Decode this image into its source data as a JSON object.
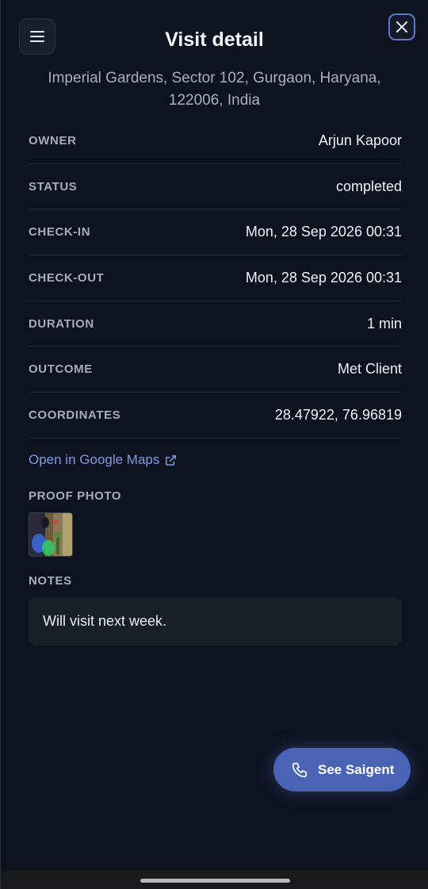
{
  "header": {
    "title": "Visit detail"
  },
  "address": "Imperial Gardens, Sector 102, Gurgaon, Haryana, 122006, India",
  "details": [
    {
      "label": "OWNER",
      "value": "Arjun Kapoor"
    },
    {
      "label": "STATUS",
      "value": "completed"
    },
    {
      "label": "CHECK-IN",
      "value": "Mon, 28 Sep 2026 00:31"
    },
    {
      "label": "CHECK-OUT",
      "value": "Mon, 28 Sep 2026 00:31"
    },
    {
      "label": "DURATION",
      "value": "1 min"
    },
    {
      "label": "OUTCOME",
      "value": "Met Client"
    },
    {
      "label": "COORDINATES",
      "value": "28.47922, 76.96819"
    }
  ],
  "maps_link": {
    "label": "Open in Google Maps",
    "icon": "external-link-icon"
  },
  "proof_photo": {
    "label": "PROOF PHOTO"
  },
  "notes": {
    "label": "NOTES",
    "text": "Will visit next week."
  },
  "fab": {
    "label": "See Saigent",
    "icon": "phone-icon"
  },
  "colors": {
    "background": "#0f1320",
    "accent": "#4a63b5",
    "link": "#7d9be6"
  }
}
